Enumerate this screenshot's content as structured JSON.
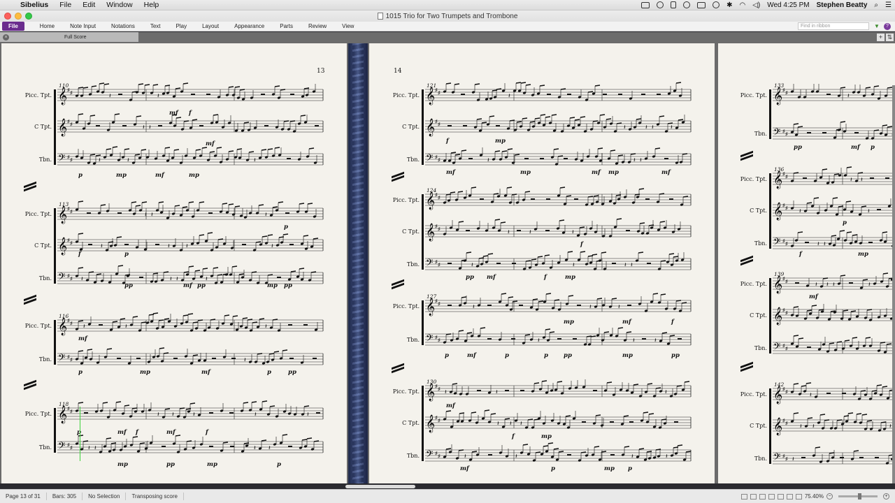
{
  "menubar": {
    "app_name": "Sibelius",
    "items": [
      "File",
      "Edit",
      "Window",
      "Help"
    ],
    "clock": "Wed 4:25 PM",
    "user": "Stephen Beatty"
  },
  "window": {
    "title": "1015 Trio for Two Trumpets and Trombone"
  },
  "ribbon": {
    "file_label": "File",
    "tabs": [
      "Home",
      "Note Input",
      "Notations",
      "Text",
      "Play",
      "Layout",
      "Appearance",
      "Parts",
      "Review",
      "View"
    ],
    "find_placeholder": "Find in ribbon"
  },
  "score_tab": {
    "label": "Full Score"
  },
  "pages": {
    "left_page_number": "13",
    "right_page_number": "14"
  },
  "instruments": {
    "picc": "Picc. Tpt.",
    "ctpt": "C Tpt.",
    "tbn": "Tbn."
  },
  "bar_numbers": {
    "p13": [
      "110",
      "113",
      "116",
      "118"
    ],
    "p14": [
      "121",
      "124",
      "127",
      "130"
    ],
    "p15": [
      "133",
      "136",
      "139",
      "142"
    ]
  },
  "dynamics": {
    "mf": "mf",
    "f": "f",
    "p": "p",
    "mp": "mp",
    "pp": "pp"
  },
  "statusbar": {
    "page": "Page 13 of 31",
    "bars": "Bars: 305",
    "selection": "No Selection",
    "transposing": "Transposing score",
    "zoom": "75.40%"
  }
}
